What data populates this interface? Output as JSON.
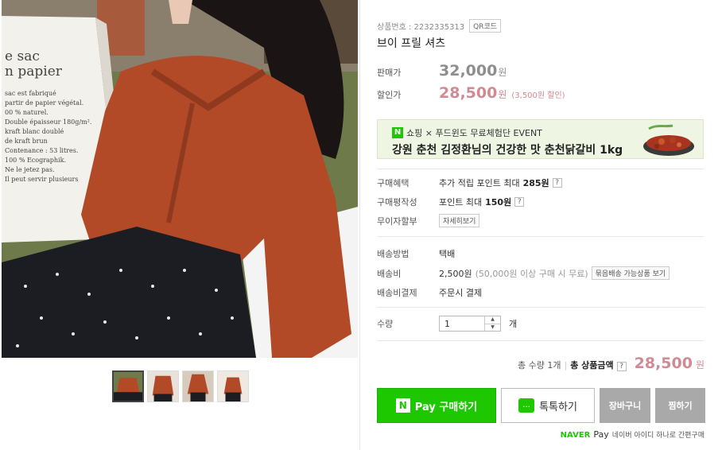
{
  "product": {
    "number_label": "상품번호 : 2232335313",
    "qr_label": "QR코드",
    "title": "브이 프릴 셔츠"
  },
  "price": {
    "sell_label": "판매가",
    "sell_value": "32,000",
    "sell_unit": "원",
    "sale_label": "할인가",
    "sale_value": "28,500",
    "sale_unit": "원",
    "sale_note": "(3,500원 할인)"
  },
  "banner": {
    "line1": "쇼핑 × 푸드윈도 무료체험단 EVENT",
    "badge": "N",
    "line2": "강원 춘천 김정환님의 건강한 맛 춘천닭갈비 1kg"
  },
  "benefits": {
    "buy_label": "구매혜택",
    "buy_text": "추가 적립 포인트 최대",
    "buy_points": "285원",
    "review_label": "구매평작성",
    "review_text": "포인트 최대",
    "review_points": "150원",
    "installment_label": "무이자할부",
    "installment_btn": "자세히보기",
    "help": "?"
  },
  "shipping": {
    "method_label": "배송방법",
    "method_value": "택배",
    "fee_label": "배송비",
    "fee_value": "2,500원",
    "fee_note": "(50,000원 이상 구매 시 무료)",
    "fee_btn": "묶음배송 가능상품 보기",
    "pay_label": "배송비결제",
    "pay_value": "주문시 결제"
  },
  "quantity": {
    "label": "수량",
    "value": "1",
    "unit": "개",
    "up": "▲",
    "down": "▼"
  },
  "total": {
    "qty_text": "총 수량 1개",
    "sep": "|",
    "label": "총 상품금액",
    "help": "?",
    "value": "28,500",
    "unit": "원"
  },
  "buttons": {
    "pay_n": "N",
    "pay_label": "Pay 구매하기",
    "talk_label": "톡톡하기",
    "talk_icon": "...",
    "cart_label": "장바구니",
    "wish_label": "찜하기"
  },
  "npay": {
    "naver": "NAVER",
    "pay": "Pay",
    "text": "네이버 아이디 하나로 간편구매"
  },
  "photo": {
    "bag_lines": [
      "e sac",
      "n papier",
      "sac est fabriqué",
      "partir de papier végétal.",
      "00 % naturel.",
      "Double épaisseur 180g/m².",
      "kraft blanc doublé",
      "de kraft brun",
      "Contenance : 53 litres.",
      "100 % Ecographik.",
      "Ne le jetez pas.",
      "Il peut servir plusieurs"
    ]
  }
}
